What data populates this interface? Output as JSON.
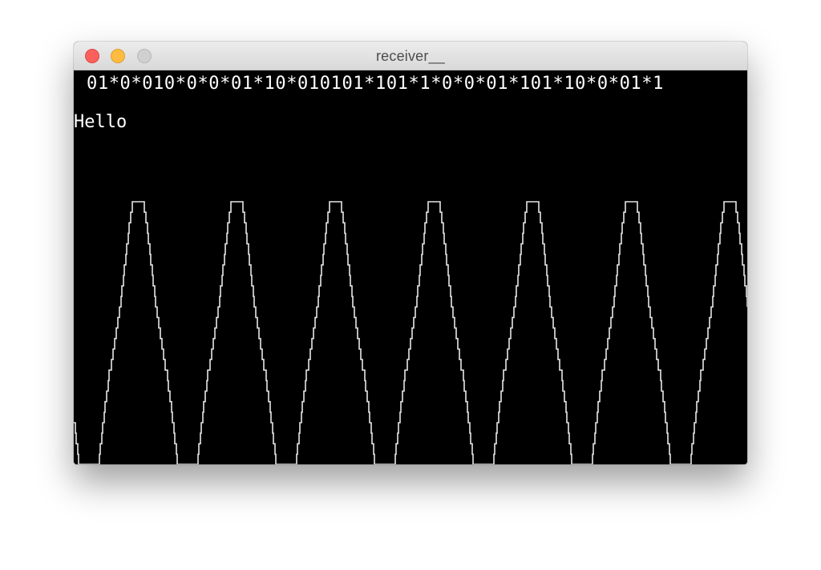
{
  "window": {
    "title": "receiver__"
  },
  "terminal": {
    "bitstream": "01*0*010*0*0*01*10*010101*101*1*0*0*01*101*10*0*01*1",
    "message": "Hello"
  },
  "colors": {
    "background": "#000000",
    "text": "#ffffff",
    "waveform": "#e6e6e6",
    "close": "#fc605c",
    "minimize": "#fdbc40",
    "zoom_disabled": "#d0d0d0"
  }
}
